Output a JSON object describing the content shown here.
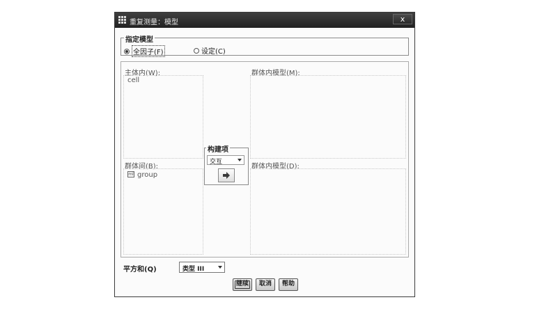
{
  "window": {
    "title": "重复测量：模型",
    "close_label": "x"
  },
  "specify_model": {
    "legend": "指定模型",
    "full_factorial": {
      "label": "全因子(F)",
      "selected": true
    },
    "custom": {
      "label": "设定(C)",
      "selected": false
    }
  },
  "within_subjects": {
    "label": "主体内(W):",
    "items": [
      "cell"
    ]
  },
  "within_model": {
    "label": "群体内模型(M):"
  },
  "between_subjects": {
    "label": "群体间(B):",
    "items": [
      "group"
    ]
  },
  "between_model": {
    "label": "群体内模型(D):"
  },
  "build_term": {
    "legend": "构建项",
    "type_value": "交互"
  },
  "sum_of_squares": {
    "label": "平方和(Q)",
    "value": "类型 III"
  },
  "buttons": {
    "continue": "继续",
    "cancel": "取消",
    "help": "帮助"
  }
}
